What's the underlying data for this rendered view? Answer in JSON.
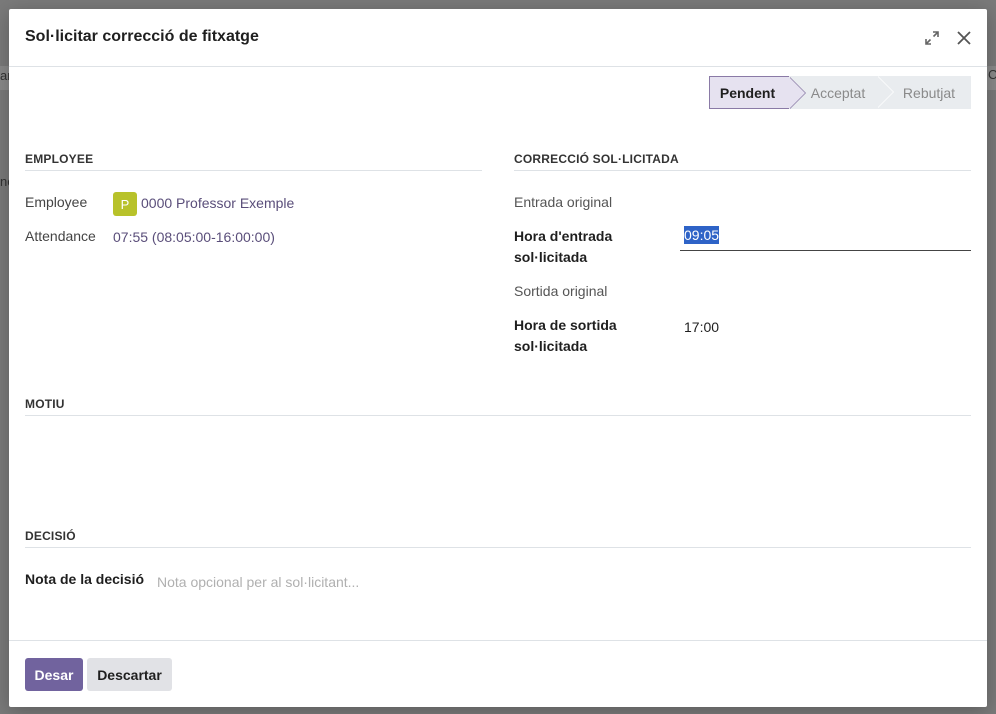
{
  "background": {
    "fragment_left_1": "ar",
    "fragment_left_2": "ne",
    "fragment_right": "C"
  },
  "dialog": {
    "title": "Sol·licitar correcció de fitxatge"
  },
  "statusbar": {
    "steps": [
      {
        "label": "Pendent",
        "active": true
      },
      {
        "label": "Acceptat",
        "active": false
      },
      {
        "label": "Rebutjat",
        "active": false
      }
    ]
  },
  "employee_section": {
    "title": "EMPLOYEE",
    "employee_label": "Employee",
    "employee_initial": "P",
    "employee_value": "0000 Professor Exemple",
    "attendance_label": "Attendance",
    "attendance_value": "07:55 (08:05:00-16:00:00)"
  },
  "correction_section": {
    "title": "CORRECCIÓ SOL·LICITADA",
    "original_entry_label": "Entrada original",
    "requested_entry_label_line1": "Hora d'entrada",
    "requested_entry_label_line2": "sol·licitada",
    "requested_entry_value": "09:05",
    "original_exit_label": "Sortida original",
    "requested_exit_label_line1": "Hora de sortida",
    "requested_exit_label_line2": "sol·licitada",
    "requested_exit_value": "17:00"
  },
  "reason_section": {
    "title": "MOTIU"
  },
  "decision_section": {
    "title": "DECISIÓ",
    "note_label": "Nota de la decisió",
    "note_placeholder": "Nota opcional per al sol·licitant..."
  },
  "footer": {
    "save_label": "Desar",
    "discard_label": "Descartar"
  },
  "colors": {
    "primary": "#71639e",
    "avatar": "#b8c22a",
    "selection": "#2e63c7"
  }
}
